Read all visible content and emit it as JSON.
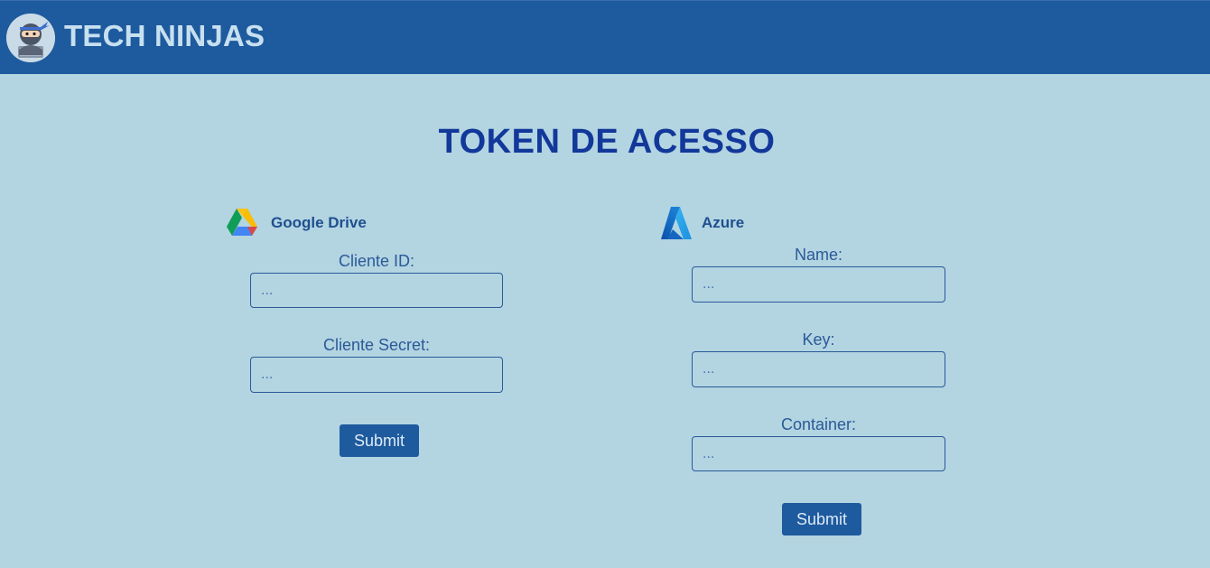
{
  "header": {
    "app_title": "TECH NINJAS",
    "logo_icon": "ninja-avatar-icon"
  },
  "page": {
    "title": "TOKEN DE ACESSO"
  },
  "google_drive": {
    "name": "Google Drive",
    "icon": "google-drive-icon",
    "client_id_label": "Cliente ID:",
    "client_id_placeholder": "...",
    "client_id_value": "",
    "client_secret_label": "Cliente Secret:",
    "client_secret_placeholder": "...",
    "client_secret_value": "",
    "submit_label": "Submit"
  },
  "azure": {
    "name": "Azure",
    "icon": "azure-icon",
    "name_label": "Name:",
    "name_placeholder": "...",
    "name_value": "",
    "key_label": "Key:",
    "key_placeholder": "...",
    "key_value": "",
    "container_label": "Container:",
    "container_placeholder": "...",
    "container_value": "",
    "submit_label": "Submit"
  },
  "colors": {
    "background": "#b3d4e1",
    "header": "#1e5a9e",
    "title": "#12389a",
    "button": "#1e5a9e"
  }
}
